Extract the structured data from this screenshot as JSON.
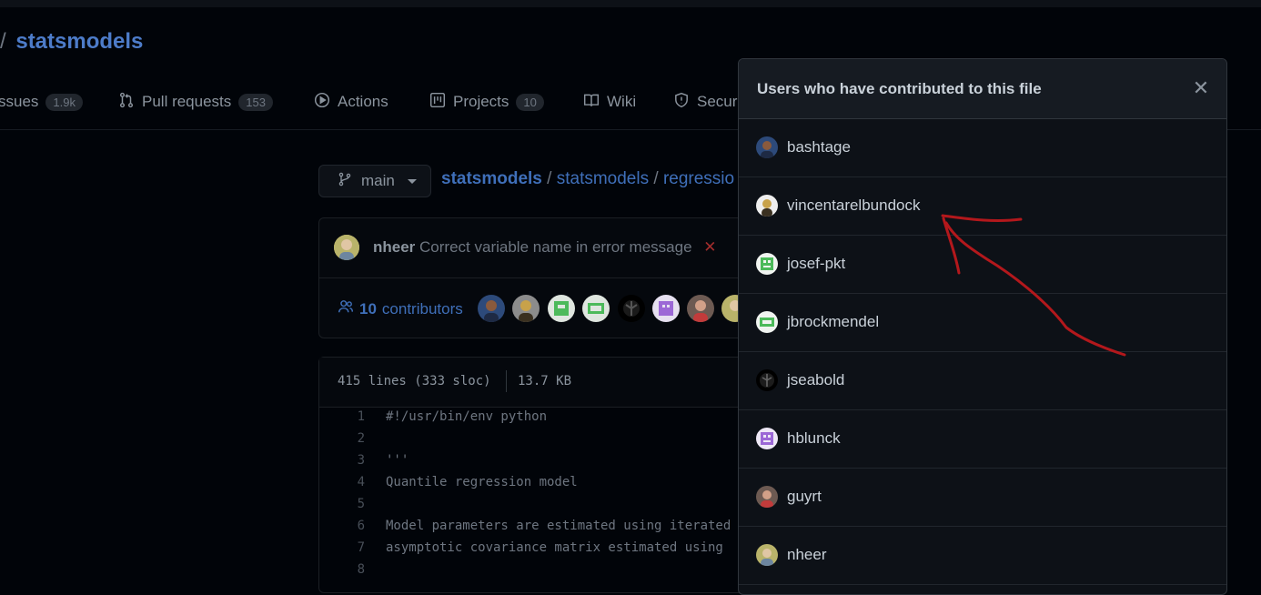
{
  "repo": {
    "separator": "/",
    "name": "statsmodels"
  },
  "tabs": [
    {
      "label": "Issues",
      "display": "ssues",
      "count": "1.9k",
      "icon": "issue-icon"
    },
    {
      "label": "Pull requests",
      "count": "153",
      "icon": "pull-request-icon"
    },
    {
      "label": "Actions",
      "count": "",
      "icon": "play-icon"
    },
    {
      "label": "Projects",
      "count": "10",
      "icon": "project-icon"
    },
    {
      "label": "Wiki",
      "count": "",
      "icon": "book-icon"
    },
    {
      "label": "Security",
      "display": "Secur",
      "count": "",
      "icon": "shield-icon"
    }
  ],
  "branch": {
    "label": "main"
  },
  "breadcrumb": {
    "owner": "statsmodels",
    "repo": "statsmodels",
    "path": "regressio",
    "sep": "/"
  },
  "commit": {
    "author": "nheer",
    "message": "Correct variable name in error message",
    "status": "✕"
  },
  "contributors": {
    "count": "10",
    "label": "contributors"
  },
  "file": {
    "lines": "415 lines (333 sloc)",
    "size": "13.7 KB",
    "code": [
      {
        "n": "1",
        "t": "#!/usr/bin/env python"
      },
      {
        "n": "2",
        "t": ""
      },
      {
        "n": "3",
        "t": "'''"
      },
      {
        "n": "4",
        "t": "Quantile regression model"
      },
      {
        "n": "5",
        "t": ""
      },
      {
        "n": "6",
        "t": "Model parameters are estimated using iterated"
      },
      {
        "n": "7",
        "t": "asymptotic covariance matrix estimated using"
      },
      {
        "n": "8",
        "t": ""
      }
    ]
  },
  "modal": {
    "title": "Users who have contributed to this file",
    "close": "✕",
    "users": [
      "bashtage",
      "vincentarelbundock",
      "josef-pkt",
      "jbrockmendel",
      "jseabold",
      "hblunck",
      "guyrt",
      "nheer"
    ]
  },
  "colors": {
    "link": "#3f6fb9",
    "annotation": "#b3181c",
    "background": "#010409"
  }
}
